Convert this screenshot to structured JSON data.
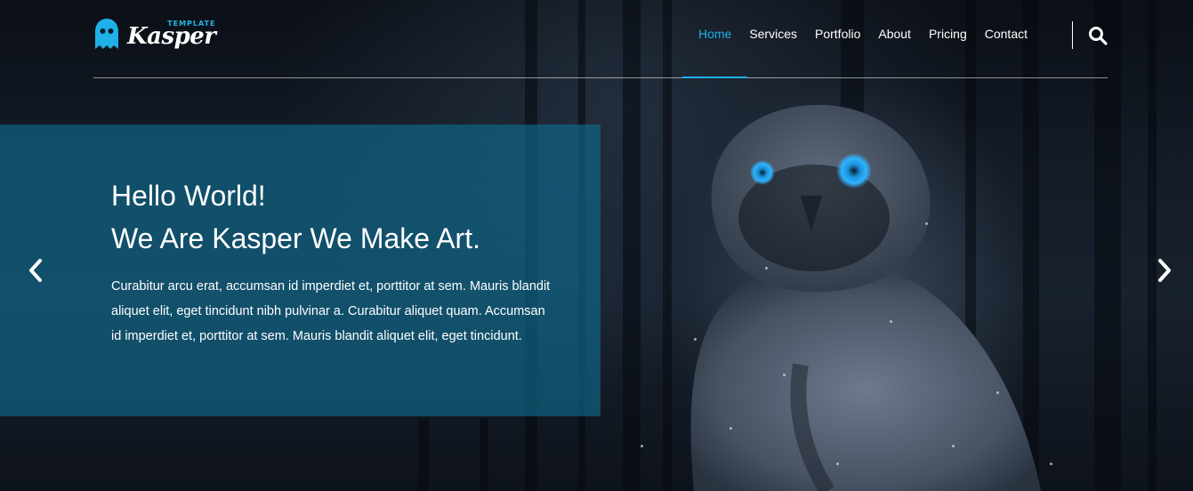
{
  "brand": {
    "name": "Kasper",
    "tagline": "TEMPLATE",
    "accent_color": "#1fb0e6",
    "icon": "ghost-icon"
  },
  "nav": {
    "items": [
      {
        "label": "Home",
        "active": true
      },
      {
        "label": "Services",
        "active": false
      },
      {
        "label": "Portfolio",
        "active": false
      },
      {
        "label": "About",
        "active": false
      },
      {
        "label": "Pricing",
        "active": false
      },
      {
        "label": "Contact",
        "active": false
      }
    ],
    "search_icon": "search-icon"
  },
  "slide": {
    "heading_line1": "Hello World!",
    "heading_line2": "We Are Kasper We Make Art.",
    "body": "Curabitur arcu erat, accumsan id imperdiet et, porttitor at sem. Mauris blandit aliquet elit, eget tincidunt nibh pulvinar a. Curabitur aliquet quam. Accumsan id imperdiet et, porttitor at sem. Mauris blandit aliquet elit, eget tincidunt.",
    "box_color": "#0e6e91",
    "prev_icon": "chevron-left-icon",
    "next_icon": "chevron-right-icon"
  }
}
